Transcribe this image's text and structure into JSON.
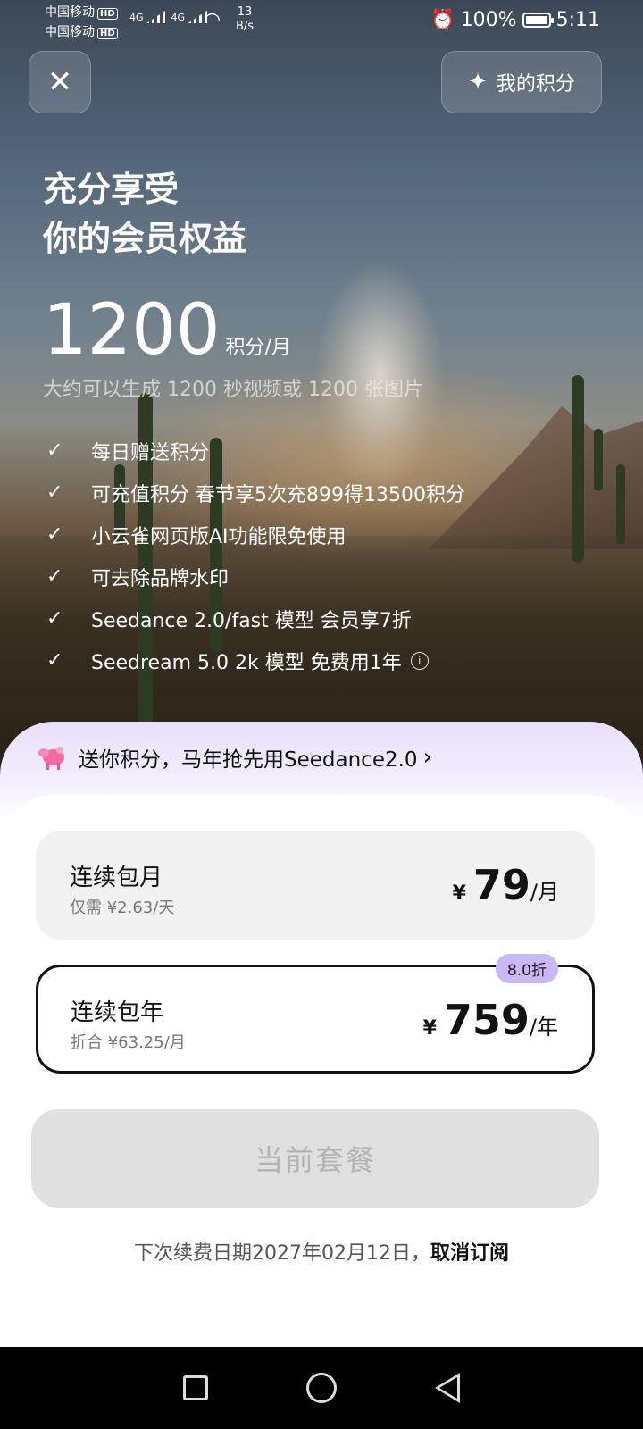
{
  "status_bar": {
    "carrier1": "中国移动",
    "carrier2": "中国移动",
    "hd": "HD",
    "signal1": "4G",
    "signal2": "4G",
    "speed_value": "13",
    "speed_unit": "B/s",
    "battery": "100%",
    "time": "5:11"
  },
  "header": {
    "close_icon": "close-icon",
    "points_label": "我的积分",
    "points_icon": "sparkle-icon"
  },
  "hero": {
    "title_line1": "充分享受",
    "title_line2": "你的会员权益",
    "points_number": "1200",
    "points_unit": "积分/月",
    "subline": "大约可以生成 1200 秒视频或 1200 张图片"
  },
  "benefits": [
    "每日赠送积分",
    "可充值积分 春节享5次充899得13500积分",
    "小云雀网页版AI功能限免使用",
    "可去除品牌水印",
    "Seedance 2.0/fast 模型 会员享7折",
    "Seedream 5.0 2k 模型 免费用1年"
  ],
  "promo": {
    "text": "送你积分，马年抢先用Seedance2.0"
  },
  "plans": [
    {
      "name": "连续包月",
      "sub": "仅需 ¥2.63/天",
      "currency": "¥",
      "amount": "79",
      "period": "/月"
    },
    {
      "name": "连续包年",
      "sub": "折合 ¥63.25/月",
      "currency": "¥",
      "amount": "759",
      "period": "/年",
      "badge": "8.0折"
    }
  ],
  "cta": {
    "label": "当前套餐"
  },
  "renew": {
    "text": "下次续费日期2027年02月12日，",
    "cancel_link": "取消订阅"
  },
  "colors": {
    "accent_badge": "#c8b8f5",
    "promo_bg": "#e8dffb",
    "cta_bg": "#e0e0e0"
  }
}
